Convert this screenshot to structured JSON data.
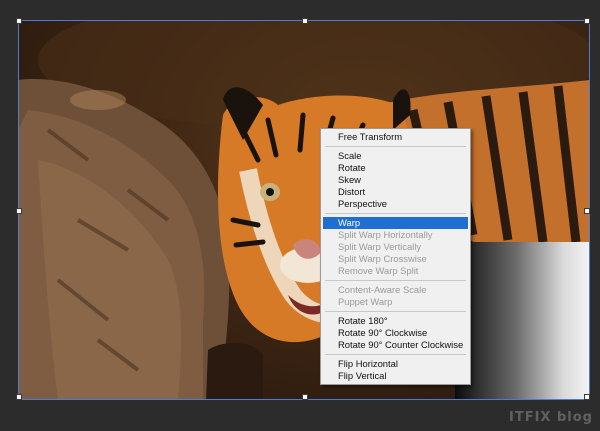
{
  "canvas": {
    "background_color": "#2c2c2c",
    "selection_color": "#4e7bd6"
  },
  "context_menu": {
    "highlight_color": "#1f6fd1",
    "groups": [
      [
        {
          "label": "Free Transform",
          "enabled": true
        }
      ],
      [
        {
          "label": "Scale",
          "enabled": true
        },
        {
          "label": "Rotate",
          "enabled": true
        },
        {
          "label": "Skew",
          "enabled": true
        },
        {
          "label": "Distort",
          "enabled": true
        },
        {
          "label": "Perspective",
          "enabled": true
        }
      ],
      [
        {
          "label": "Warp",
          "enabled": true,
          "highlighted": true
        },
        {
          "label": "Split Warp Horizontally",
          "enabled": false
        },
        {
          "label": "Split Warp Vertically",
          "enabled": false
        },
        {
          "label": "Split Warp Crosswise",
          "enabled": false
        },
        {
          "label": "Remove Warp Split",
          "enabled": false
        }
      ],
      [
        {
          "label": "Content-Aware Scale",
          "enabled": false
        },
        {
          "label": "Puppet Warp",
          "enabled": false
        }
      ],
      [
        {
          "label": "Rotate 180°",
          "enabled": true
        },
        {
          "label": "Rotate 90° Clockwise",
          "enabled": true
        },
        {
          "label": "Rotate 90° Counter Clockwise",
          "enabled": true
        }
      ],
      [
        {
          "label": "Flip Horizontal",
          "enabled": true
        },
        {
          "label": "Flip Vertical",
          "enabled": true
        }
      ]
    ]
  },
  "watermark": {
    "text": "ITFIX blog"
  }
}
